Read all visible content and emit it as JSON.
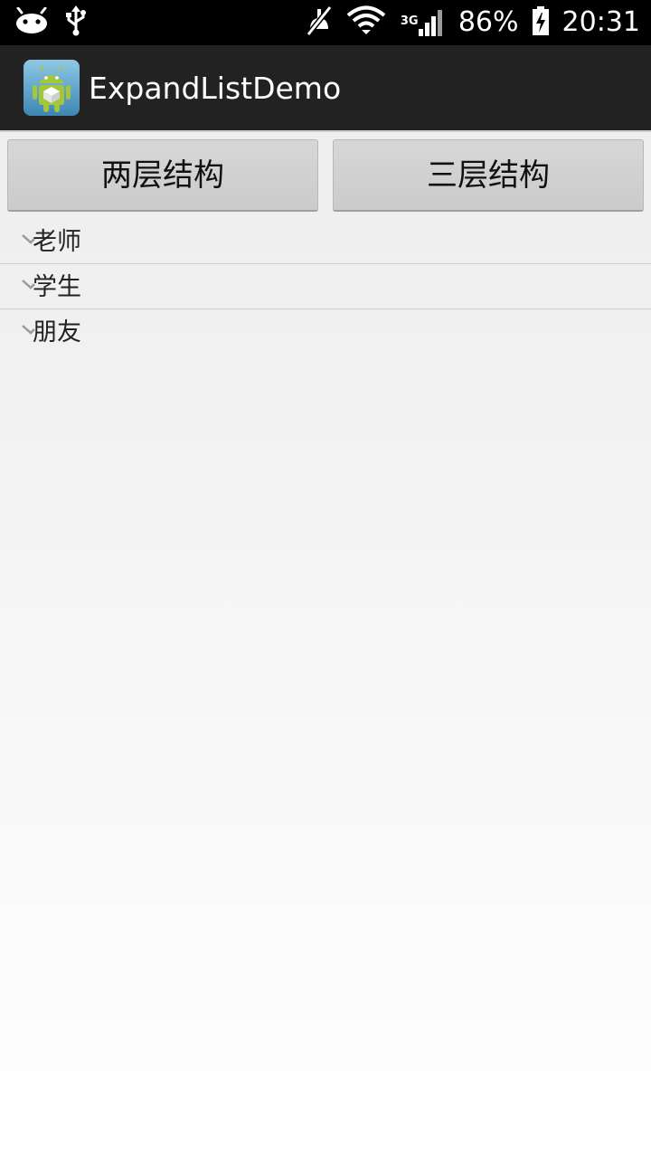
{
  "status_bar": {
    "network_label": "3G",
    "battery_percent": "86%",
    "time": "20:31",
    "icons": [
      "android-notification-icon",
      "usb-icon",
      "mute-icon",
      "wifi-icon",
      "signal-icon",
      "battery-charging-icon"
    ]
  },
  "action_bar": {
    "title": "ExpandListDemo",
    "icon": "android-app-icon"
  },
  "buttons": {
    "two_level": "两层结构",
    "three_level": "三层结构"
  },
  "list": {
    "groups": [
      {
        "label": "老师"
      },
      {
        "label": "学生"
      },
      {
        "label": "朋友"
      }
    ]
  },
  "colors": {
    "status_bar_bg": "#000000",
    "action_bar_bg": "#222222",
    "button_bg": "#cfcfcf"
  }
}
